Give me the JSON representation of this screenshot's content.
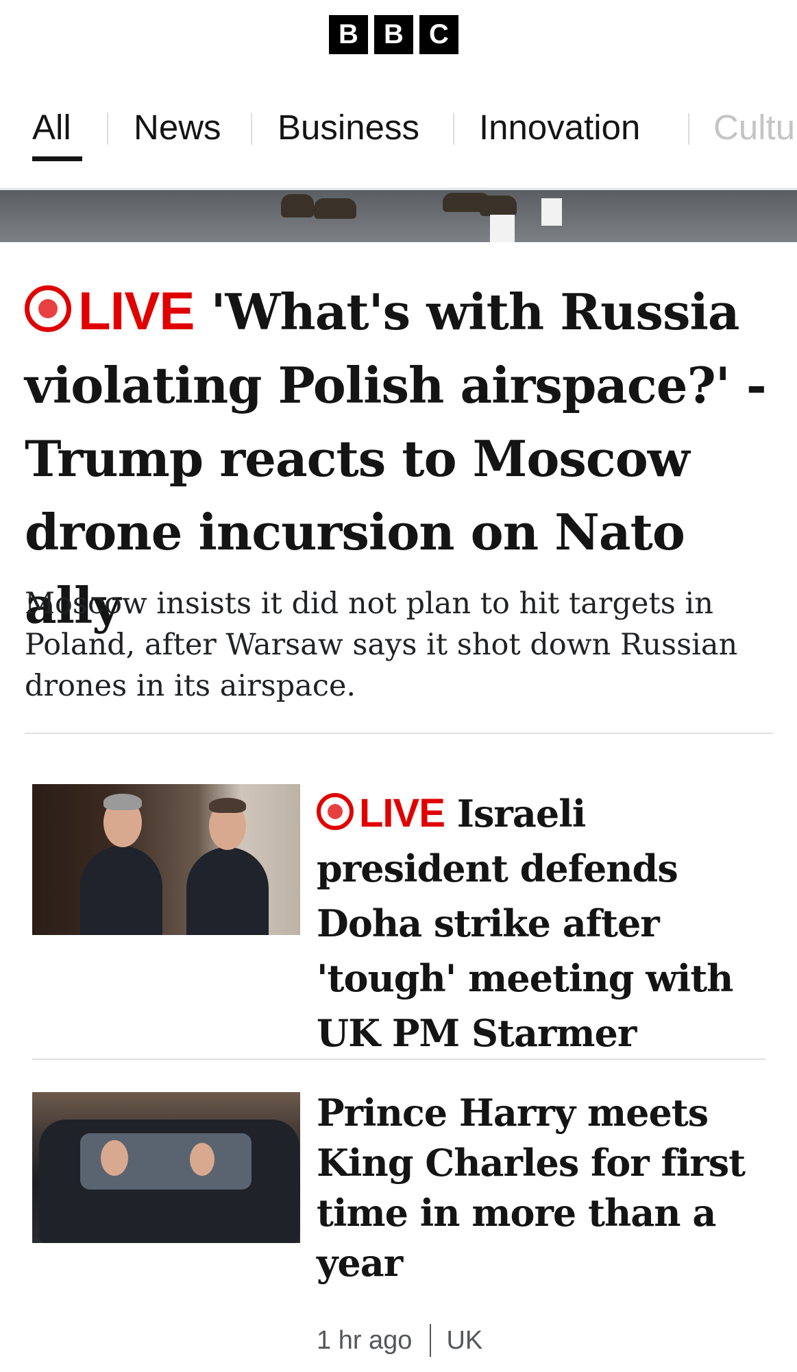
{
  "header": {
    "logo_letters": [
      "B",
      "B",
      "C"
    ]
  },
  "nav": {
    "tabs": [
      {
        "label": "All",
        "active": true
      },
      {
        "label": "News"
      },
      {
        "label": "Business"
      },
      {
        "label": "Innovation"
      },
      {
        "label": "Cultu"
      }
    ]
  },
  "lead": {
    "live_label": "LIVE",
    "headline": "'What's with Russia violating Polish airspace?' - Trump reacts to Moscow drone incursion on Nato ally",
    "summary": "Moscow insists it did not plan to hit targets in Poland, after Warsaw says it shot down Russian drones in its airspace."
  },
  "stories": [
    {
      "live_label": "LIVE",
      "headline": "Israeli president defends Doha strike after 'tough' meeting with UK PM Starmer"
    },
    {
      "headline": "Prince Harry meets King Charles for first time in more than a year",
      "time": "1 hr ago",
      "category": "UK"
    }
  ],
  "colors": {
    "live_red": "#e00000",
    "text": "#141414",
    "muted": "#545658",
    "divider": "#e0e0e0"
  }
}
